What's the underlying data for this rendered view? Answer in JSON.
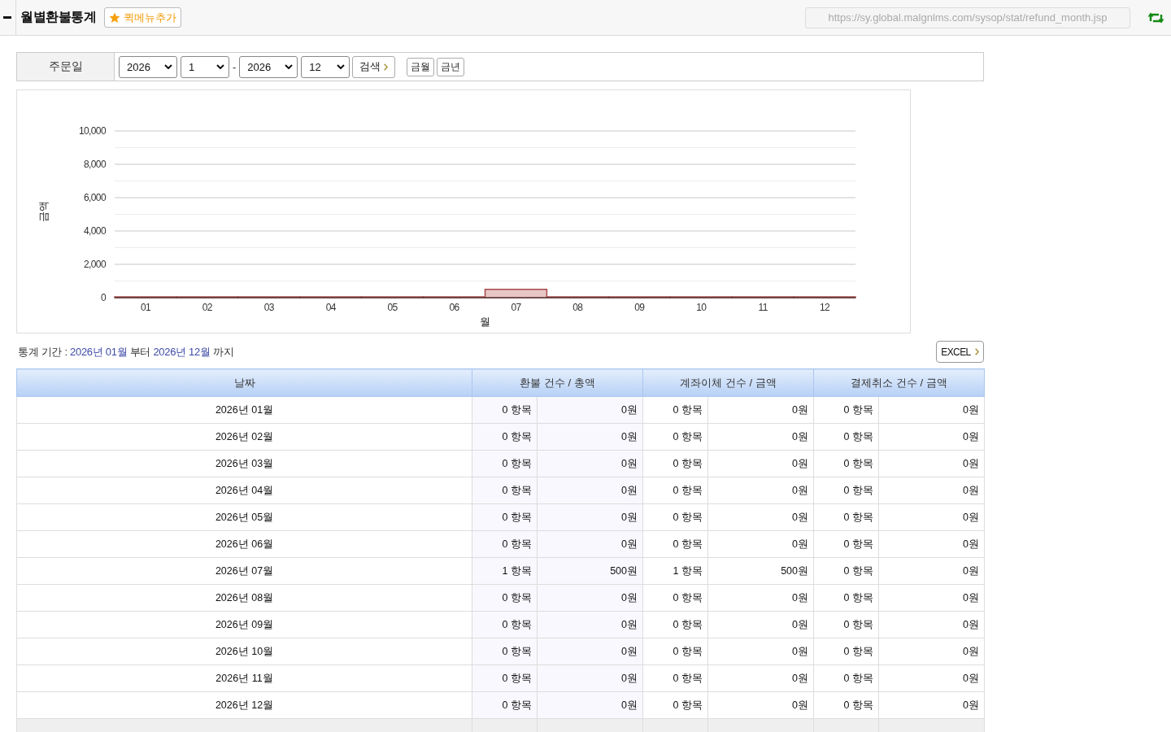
{
  "header": {
    "title": "월별환불통계",
    "quick_menu_button": "퀵메뉴추가",
    "url": "https://sy.global.malgnlms.com/sysop/stat/refund_month.jsp"
  },
  "search": {
    "label": "주문일",
    "from": [
      {
        "kind": "year",
        "value": "2026"
      },
      {
        "kind": "month",
        "value": "1"
      }
    ],
    "separator": "-",
    "to": [
      {
        "kind": "year",
        "value": "2026"
      },
      {
        "kind": "month",
        "value": "12"
      }
    ],
    "search_button": "검색",
    "quick_buttons": [
      "금월",
      "금년"
    ]
  },
  "chart": {
    "chart_data": {
      "type": "bar",
      "xlabel": "월",
      "ylabel": "금액",
      "categories": [
        "01",
        "02",
        "03",
        "04",
        "05",
        "06",
        "07",
        "08",
        "09",
        "10",
        "11",
        "12"
      ],
      "values": [
        0,
        0,
        0,
        0,
        0,
        0,
        500,
        0,
        0,
        0,
        0,
        0
      ],
      "ylim": [
        0,
        10000
      ],
      "yticks": [
        {
          "value": 0,
          "label": "0"
        },
        {
          "value": 2000,
          "label": "2,000"
        },
        {
          "value": 4000,
          "label": "4,000"
        },
        {
          "value": 6000,
          "label": "6,000"
        },
        {
          "value": 8000,
          "label": "8,000"
        },
        {
          "value": 10000,
          "label": "10,000"
        }
      ],
      "grid": true
    }
  },
  "period": {
    "label": "통계 기간 :",
    "start": "2026년 01월",
    "from_word": "부터",
    "end": "2026년 12월",
    "to_word": "까지"
  },
  "excel_button": "EXCEL",
  "table": {
    "columns": [
      "날짜",
      "환불 건수 / 총액",
      "계좌이체 건수 / 금액",
      "결제취소 건수 / 금액"
    ],
    "rows": [
      {
        "date": "2026년 01월",
        "refund": {
          "count": "0 항목",
          "total": "0원"
        },
        "transfer": {
          "count": "0 항목",
          "amount": "0원"
        },
        "cancel": {
          "count": "0 항목",
          "amount": "0원"
        }
      },
      {
        "date": "2026년 02월",
        "refund": {
          "count": "0 항목",
          "total": "0원"
        },
        "transfer": {
          "count": "0 항목",
          "amount": "0원"
        },
        "cancel": {
          "count": "0 항목",
          "amount": "0원"
        }
      },
      {
        "date": "2026년 03월",
        "refund": {
          "count": "0 항목",
          "total": "0원"
        },
        "transfer": {
          "count": "0 항목",
          "amount": "0원"
        },
        "cancel": {
          "count": "0 항목",
          "amount": "0원"
        }
      },
      {
        "date": "2026년 04월",
        "refund": {
          "count": "0 항목",
          "total": "0원"
        },
        "transfer": {
          "count": "0 항목",
          "amount": "0원"
        },
        "cancel": {
          "count": "0 항목",
          "amount": "0원"
        }
      },
      {
        "date": "2026년 05월",
        "refund": {
          "count": "0 항목",
          "total": "0원"
        },
        "transfer": {
          "count": "0 항목",
          "amount": "0원"
        },
        "cancel": {
          "count": "0 항목",
          "amount": "0원"
        }
      },
      {
        "date": "2026년 06월",
        "refund": {
          "count": "0 항목",
          "total": "0원"
        },
        "transfer": {
          "count": "0 항목",
          "amount": "0원"
        },
        "cancel": {
          "count": "0 항목",
          "amount": "0원"
        }
      },
      {
        "date": "2026년 07월",
        "refund": {
          "count": "1 항목",
          "total": "500원"
        },
        "transfer": {
          "count": "1 항목",
          "amount": "500원"
        },
        "cancel": {
          "count": "0 항목",
          "amount": "0원"
        }
      },
      {
        "date": "2026년 08월",
        "refund": {
          "count": "0 항목",
          "total": "0원"
        },
        "transfer": {
          "count": "0 항목",
          "amount": "0원"
        },
        "cancel": {
          "count": "0 항목",
          "amount": "0원"
        }
      },
      {
        "date": "2026년 09월",
        "refund": {
          "count": "0 항목",
          "total": "0원"
        },
        "transfer": {
          "count": "0 항목",
          "amount": "0원"
        },
        "cancel": {
          "count": "0 항목",
          "amount": "0원"
        }
      },
      {
        "date": "2026년 10월",
        "refund": {
          "count": "0 항목",
          "total": "0원"
        },
        "transfer": {
          "count": "0 항목",
          "amount": "0원"
        },
        "cancel": {
          "count": "0 항목",
          "amount": "0원"
        }
      },
      {
        "date": "2026년 11월",
        "refund": {
          "count": "0 항목",
          "total": "0원"
        },
        "transfer": {
          "count": "0 항목",
          "amount": "0원"
        },
        "cancel": {
          "count": "0 항목",
          "amount": "0원"
        }
      },
      {
        "date": "2026년 12월",
        "refund": {
          "count": "0 항목",
          "total": "0원"
        },
        "transfer": {
          "count": "0 항목",
          "amount": "0원"
        },
        "cancel": {
          "count": "0 항목",
          "amount": "0원"
        }
      }
    ]
  }
}
